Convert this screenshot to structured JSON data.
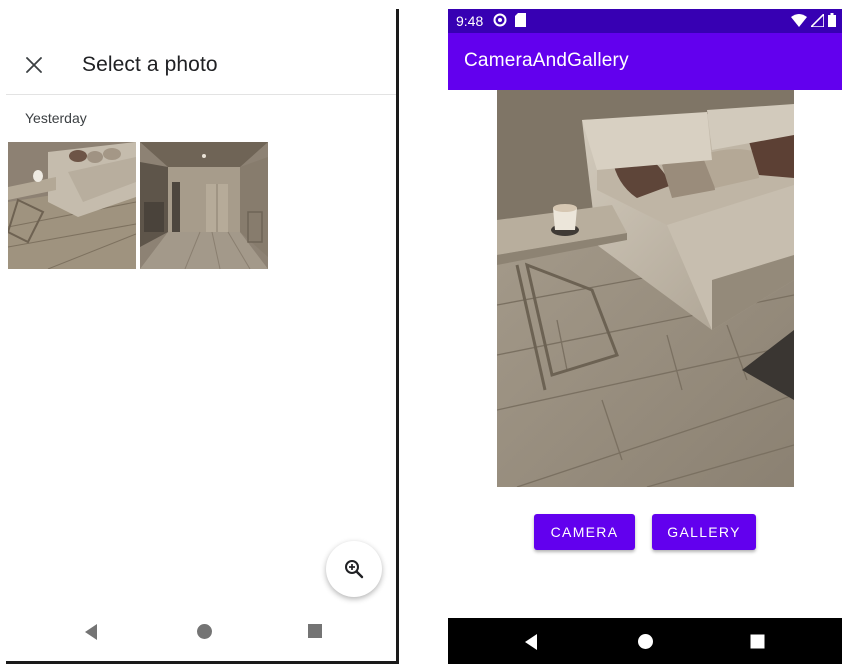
{
  "picker": {
    "title": "Select a photo",
    "section_label": "Yesterday",
    "photos": [
      {
        "description": "living room sofa photo"
      },
      {
        "description": "kitchen hallway photo"
      }
    ],
    "icons": {
      "close": "close-icon",
      "zoom": "zoom-in-icon"
    }
  },
  "app": {
    "status": {
      "time": "9:48"
    },
    "title": "CameraAndGallery",
    "buttons": {
      "camera": "CAMERA",
      "gallery": "GALLERY"
    },
    "colors": {
      "primary": "#6200ee",
      "status_bar": "#3700b3",
      "button_text": "#ffffff"
    }
  },
  "nav": {
    "icons": [
      "back-icon",
      "home-icon",
      "recents-icon"
    ]
  }
}
